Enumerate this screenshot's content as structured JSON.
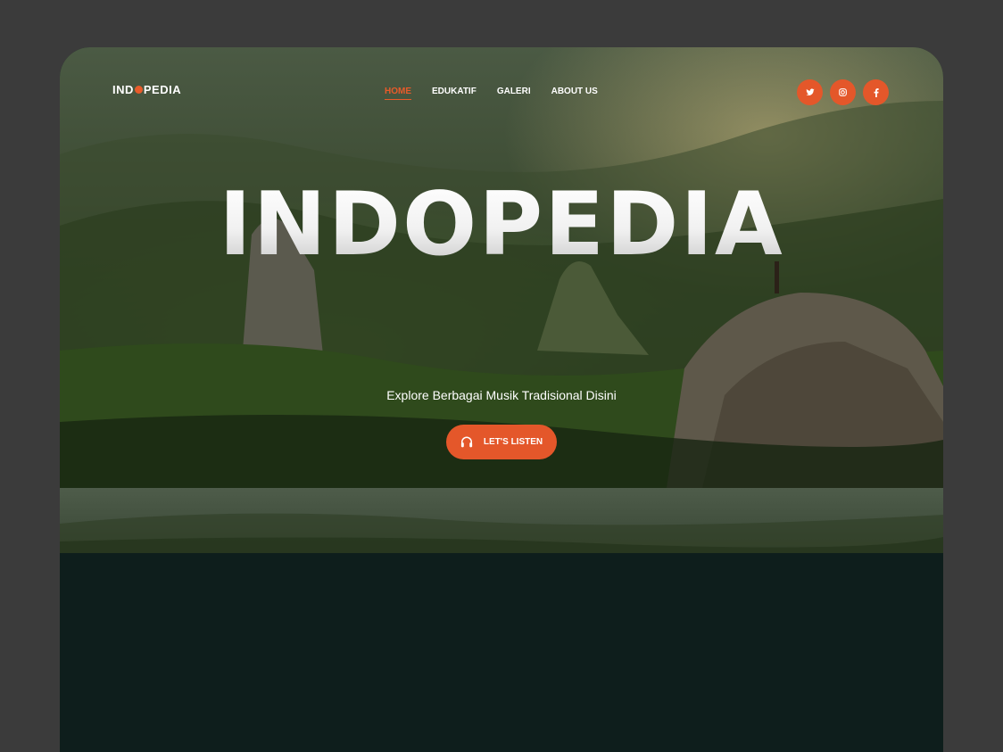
{
  "brand": {
    "logo_left": "IND",
    "logo_right": "PEDIA",
    "accent": "#e4572a"
  },
  "nav": {
    "items": [
      {
        "label": "HOME",
        "active": true
      },
      {
        "label": "EDUKATIF",
        "active": false
      },
      {
        "label": "GALERI",
        "active": false
      },
      {
        "label": "ABOUT US",
        "active": false
      }
    ]
  },
  "social": {
    "icons": [
      {
        "icon": "twitter-icon",
        "glyph": "t"
      },
      {
        "icon": "instagram-icon",
        "glyph": "◎"
      },
      {
        "icon": "facebook-icon",
        "glyph": "f"
      }
    ]
  },
  "hero": {
    "title": "INDOPEDIA",
    "subtitle": "Explore Berbagai Musik Tradisional Disini",
    "cta_label": "LET'S LISTEN",
    "cta_icon": "headphones-icon"
  }
}
